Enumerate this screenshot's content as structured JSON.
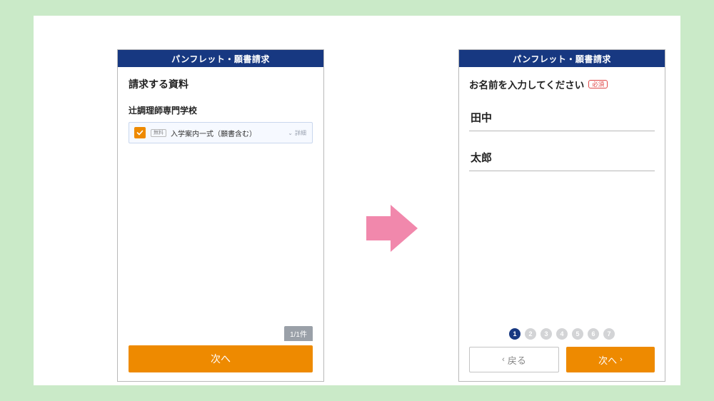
{
  "left": {
    "title": "パンフレット・願書請求",
    "heading": "請求する資料",
    "school": "辻調理師専門学校",
    "item": {
      "free_label": "無料",
      "name": "入学案内一式（願書含む）",
      "detail_label": "詳細"
    },
    "count_badge": "1/1件",
    "next_label": "次へ"
  },
  "right": {
    "title": "パンフレット・願書請求",
    "prompt": "お名前を入力してください",
    "required_badge": "必須",
    "last_name": "田中",
    "first_name": "太郎",
    "steps": [
      "1",
      "2",
      "3",
      "4",
      "5",
      "6",
      "7"
    ],
    "active_step": 1,
    "back_label": "戻る",
    "next_label": "次へ"
  }
}
